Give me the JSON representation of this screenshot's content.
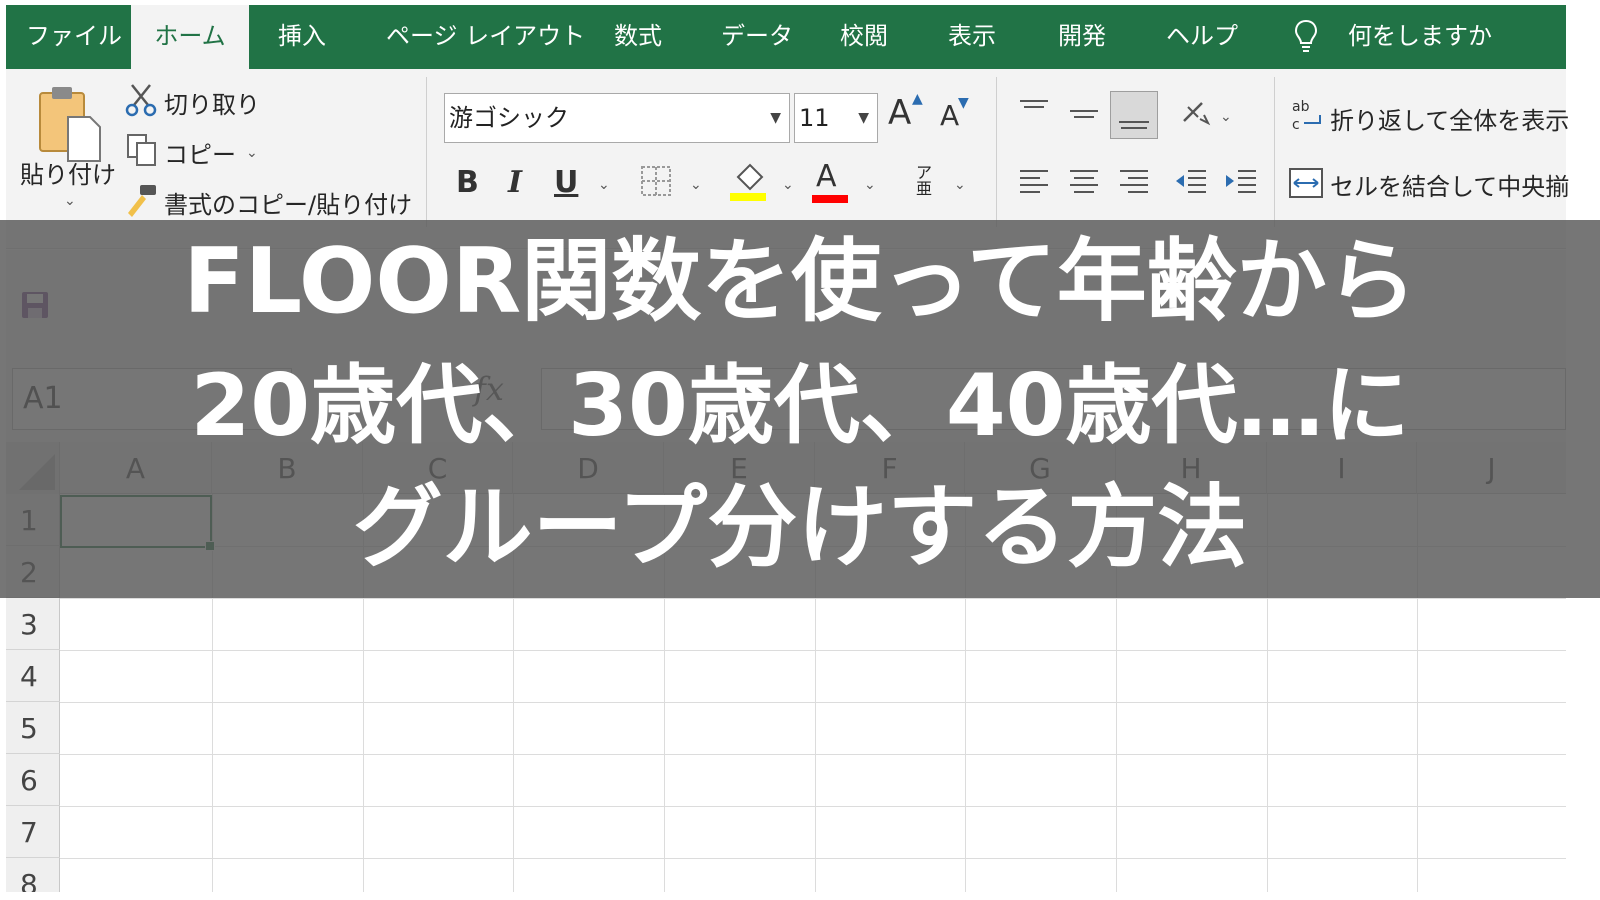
{
  "tabs": [
    {
      "label": "ファイル",
      "active": false
    },
    {
      "label": "ホーム",
      "active": true
    },
    {
      "label": "挿入",
      "active": false
    },
    {
      "label": "ページ レイアウト",
      "active": false
    },
    {
      "label": "数式",
      "active": false
    },
    {
      "label": "データ",
      "active": false
    },
    {
      "label": "校閲",
      "active": false
    },
    {
      "label": "表示",
      "active": false
    },
    {
      "label": "開発",
      "active": false
    },
    {
      "label": "ヘルプ",
      "active": false
    }
  ],
  "tell_me": "何をしますか",
  "clipboard": {
    "paste": "貼り付け",
    "cut": "切り取り",
    "copy": "コピー",
    "format_painter": "書式のコピー/貼り付け"
  },
  "font": {
    "family": "游ゴシック",
    "size": "11",
    "bold": "B",
    "italic": "I",
    "underline": "U",
    "font_color_glyph": "A",
    "furigana_glyph": "ア亜",
    "grow_glyph": "A",
    "shrink_glyph": "A"
  },
  "alignment": {
    "wrap_text": "折り返して全体を表示",
    "merge_center": "セルを結合して中央揃"
  },
  "formula_bar": {
    "name_box": "A1",
    "fx": "fx"
  },
  "grid": {
    "columns": [
      "A",
      "B",
      "C",
      "D",
      "E",
      "F",
      "G",
      "H",
      "I",
      "J"
    ],
    "rows": [
      "1",
      "2",
      "3",
      "4",
      "5",
      "6",
      "7",
      "8"
    ]
  },
  "title": {
    "line1": "FLOOR関数を使って年齢から",
    "line2": "20歳代、30歳代、40歳代…に",
    "line3": "グループ分けする方法"
  },
  "colors": {
    "excel_green": "#217346",
    "highlight_yellow": "#ffff00",
    "font_red": "#ff0000"
  }
}
